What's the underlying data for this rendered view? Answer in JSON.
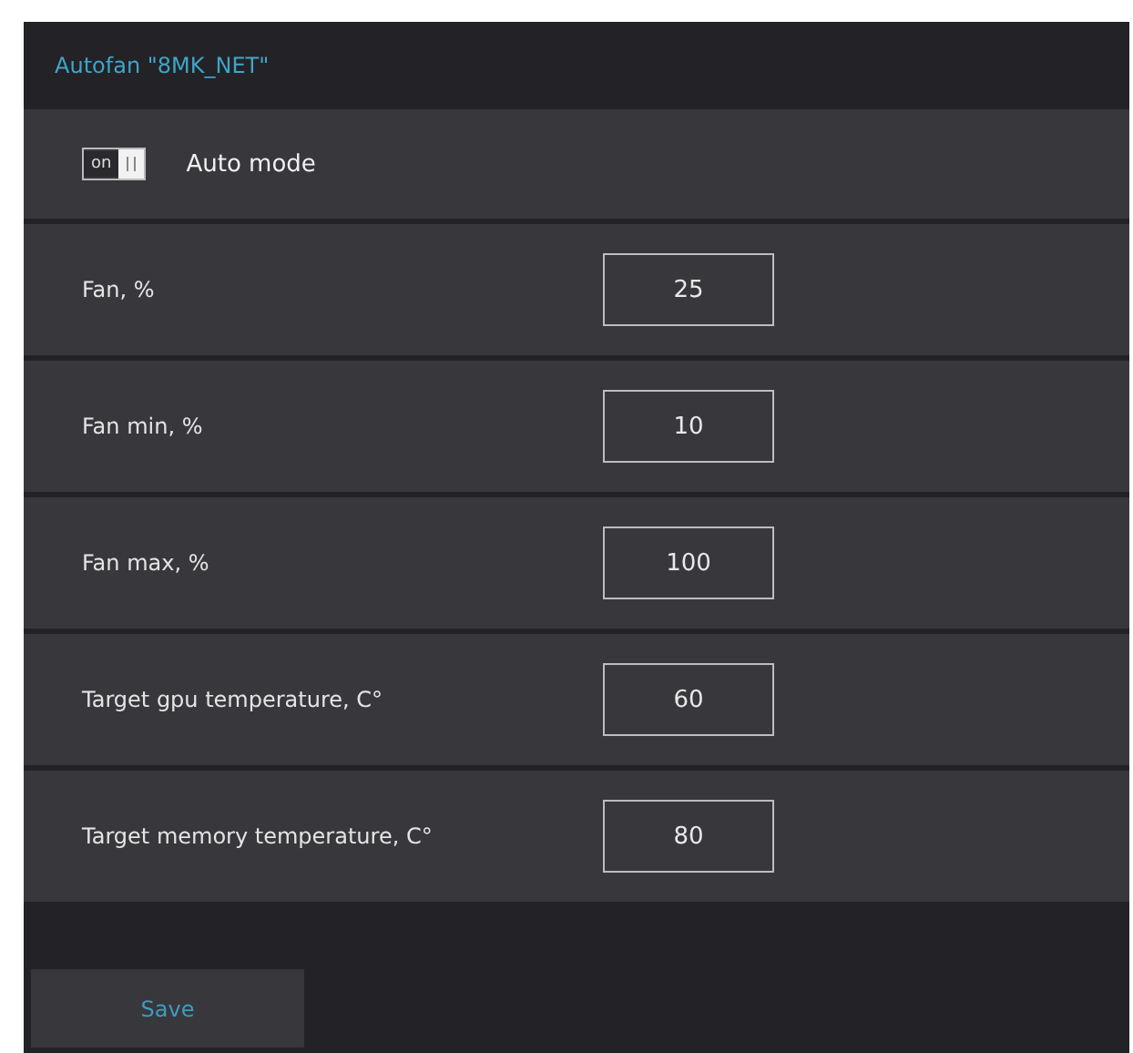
{
  "title": "Autofan \"8MK_NET\"",
  "auto_mode": {
    "label": "Auto mode",
    "switch_text": "on",
    "on": true
  },
  "fields": [
    {
      "label": "Fan, %",
      "value": "25"
    },
    {
      "label": "Fan min, %",
      "value": "10"
    },
    {
      "label": "Fan max, %",
      "value": "100"
    },
    {
      "label": "Target gpu temperature, C°",
      "value": "60"
    },
    {
      "label": "Target memory temperature, C°",
      "value": "80"
    }
  ],
  "save_button": "Save"
}
